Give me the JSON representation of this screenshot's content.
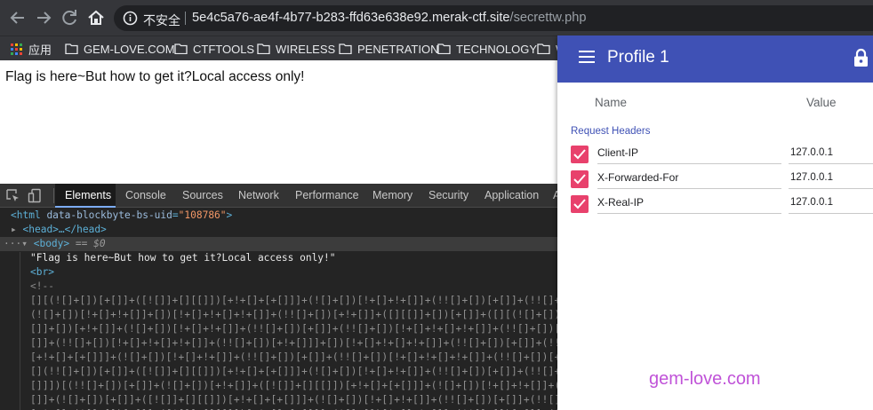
{
  "browser": {
    "security_text": "不安全",
    "url_host": "5e4c5a76-ae4f-4b77-b283-ffd63e638e92.merak-ctf.site",
    "url_path": "/secrettw.php",
    "icons": [
      "back-icon",
      "forward-icon",
      "reload-icon",
      "home-icon",
      "info-icon"
    ]
  },
  "bookmarks": {
    "apps_label": "应用",
    "apps_colors": [
      "#ea4335",
      "#fbbc04",
      "#34a853",
      "#4285f4",
      "#ea4335",
      "#fbbc04",
      "#34a853",
      "#4285f4",
      "#ea4335"
    ],
    "items": [
      {
        "label": "GEM-LOVE.COM"
      },
      {
        "label": "CTFTOOLS"
      },
      {
        "label": "WIRELESS"
      },
      {
        "label": "PENETRATION"
      },
      {
        "label": "TECHNOLOGY"
      },
      {
        "label": "W"
      }
    ]
  },
  "page": {
    "message": "Flag is here~But how to get it?Local access only!"
  },
  "devtools": {
    "tabs": [
      "Elements",
      "Console",
      "Sources",
      "Network",
      "Performance",
      "Memory",
      "Security",
      "Application",
      "A"
    ],
    "dom": {
      "html_open": "<html",
      "html_attr": "data-blockbyte-bs-uid",
      "html_attr_val": "\"108786\"",
      "html_close": ">",
      "head": "<head>…</head>",
      "body": "<body>",
      "body_marker": "== $0",
      "text_node": "\"Flag is here~But how to get it?Local access only!\"",
      "br": "<br>",
      "comment_open": "<!--",
      "jsfuck_lines": [
        "[][(![]+[])[+[]]+([![]]+[][[]])[+!+[]+[+[]]]+(![]+[])[!+[]+!+[]]+(!![]+[])[+[]]+(!![]+[])[!+[]+!+[]+!+[]]+(!![]+[])[+!+[]]][([][(![]+[])",
        "(![]+[])[!+[]+!+[]]+[])[!+[]+!+[]+!+[]]+(!![]+[])[+!+[]]+([][[]]+[])[+[]]+([][(![]+[])[+[]]+([![]]+[][[]])[+!+[]+[+[]]]+(![]+[])[!+[]+!+",
        "[]]+[])[+!+[]]+(![]+[])[!+[]+!+[]]+(!![]+[])[+[]]+(!![]+[])[!+[]+!+[]+!+[]]+(!![]+[])[+!+[]]]+[])[!+[]+!+[]+!+[]]+(!![]+[])[+[]]+([][(![",
        "[]]+(!![]+[])[!+[]+!+[]+!+[]]+(!![]+[])[+!+[]]]+[])[!+[]+!+[]+!+[]]+(!![]+[])[+[]]+(!![]+[])[+!+[]]+([][[]]+[])[+[]]+([][(![]+[])[+[]]+([![",
        "[+!+[]+[+[]]]+(![]+[])[!+[]+!+[]]+(!![]+[])[+[]]+(!![]+[])[!+[]+!+[]+!+[]]+(!![]+[])[+!+[]]]+[])[!+[]+!+[]+!+[]]+(![]+[])[!+[]+!+[]+!+[]]+(",
        "[](!![]+[])[+[]]+([![]]+[][[]])[+!+[]+[+[]]]+(![]+[])[!+[]+!+[]]+(!![]+[])[+[]]+(!![]+[])[!+[]+!+[]+!+[]]+(!![]+[])[+!+[]]]+[])[!+[]+!+[]]",
        "[]]])[(!![]+[])[+[]]+(![]+[])[+!+[]]+([![]]+[][[]])[+!+[]+[+[]]]+(![]+[])[!+[]+!+[]]+(!![]+[])[+[]]+(!![]+[])[!+[]+!+[]+!+[]]+(!![]+[])[+!+",
        "[]]+(![]+[])[+[]]+([![]]+[][[]])[+!+[]+[+[]]]+(![]+[])[!+[]+!+[]]+(!![]+[])[+[]]+(!![]+[])[!+[]+!+[]+!+[]]+(!![]+[])[+!+[]]]+[])[!+[]+!+[]+",
        "[+!+[]+(![]+[])[+[]]+([![]]+[][[]])[+!+[]+[+[]]]+(![]+[])[!+[]+!+[]]+(!![]+[])[+[]]+(!![]+[])[!+[]+!+[]+!+[]]+(!![]+[])[+!+[]]]+[])[!+[]+!+[]"
      ]
    }
  },
  "ext": {
    "title": "Profile 1",
    "col_name": "Name",
    "col_value": "Value",
    "section": "Request Headers",
    "headers": [
      {
        "name": "Client-IP",
        "value": "127.0.0.1",
        "checked": true
      },
      {
        "name": "X-Forwarded-For",
        "value": "127.0.0.1",
        "checked": true
      },
      {
        "name": "X-Real-IP",
        "value": "127.0.0.1",
        "checked": true
      }
    ],
    "accent_color": "#3f51b5",
    "checkbox_color": "#e8416c"
  },
  "watermark": "gem-love.com"
}
